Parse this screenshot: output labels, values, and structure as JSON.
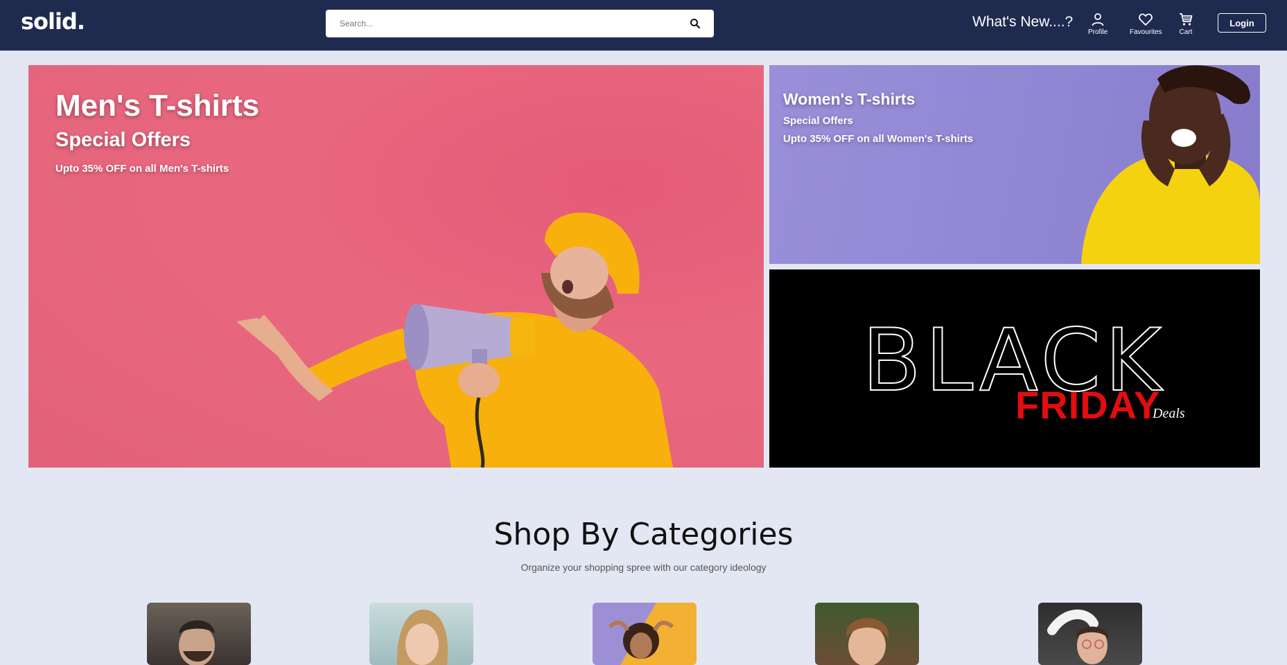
{
  "header": {
    "logo": "solid.",
    "search_placeholder": "Search...",
    "whats_new": "What's New....?",
    "nav": {
      "profile": "Profile",
      "favourites": "Favourites",
      "cart": "Cart"
    },
    "login": "Login",
    "brand_color": "#1f2a4f"
  },
  "banners": {
    "men": {
      "title": "Men's T-shirts",
      "subtitle": "Special Offers",
      "offer": "Upto 35% OFF on all Men's T-shirts",
      "bg_color": "#e9687f"
    },
    "women": {
      "title": "Women's T-shirts",
      "subtitle": "Special Offers",
      "offer": "Upto 35% OFF on all Women's T-shirts",
      "bg_color": "#9a8fd8"
    },
    "black_friday": {
      "line1": "BLACK",
      "line2": "FRIDAY",
      "line3": "Deals",
      "accent_color": "#e20d0d"
    }
  },
  "categories": {
    "heading": "Shop By Categories",
    "subheading": "Organize your shopping spree with our category ideology",
    "cards": [
      {
        "photo": "man-portrait"
      },
      {
        "photo": "woman-portrait"
      },
      {
        "photo": "girl-portrait"
      },
      {
        "photo": "boy-portrait"
      },
      {
        "photo": "woman-glasses-portrait"
      }
    ]
  }
}
